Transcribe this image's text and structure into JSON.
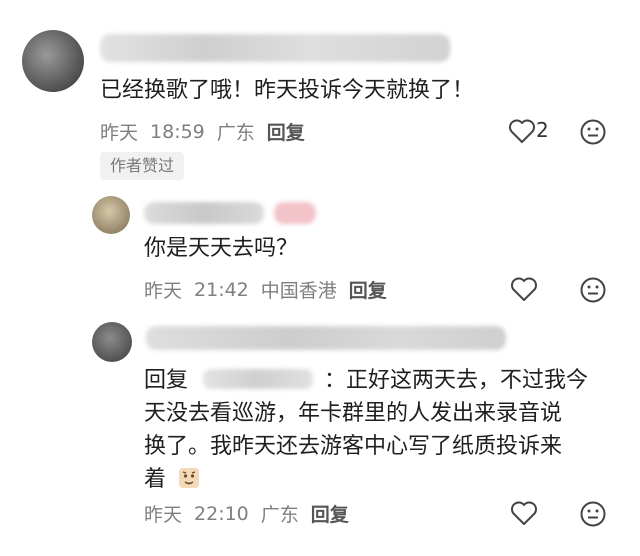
{
  "comments": [
    {
      "text": "已经换歌了哦！昨天投诉今天就换了！",
      "meta": {
        "date": "昨天",
        "time": "18:59",
        "location": "广东",
        "reply_label": "回复"
      },
      "like_count": "2",
      "author_badge": "作者赞过"
    },
    {
      "text": "你是天天去吗？",
      "meta": {
        "date": "昨天",
        "time": "21:42",
        "location": "中国香港",
        "reply_label": "回复"
      }
    },
    {
      "reply_prefix": "回复",
      "text_line1": "：正好这两天去，不过我今",
      "text_line2": "天没去看巡游，年卡群里的人发出来录音说",
      "text_line3": "换了。我昨天还去游客中心写了纸质投诉来",
      "text_line4": "着",
      "meta": {
        "date": "昨天",
        "time": "22:10",
        "location": "广东",
        "reply_label": "回复"
      }
    }
  ],
  "colors": {
    "text": "#1f1f1f",
    "meta": "#7f7f7f",
    "badge_bg": "#f1f1f1"
  },
  "icons": [
    "heart-icon",
    "emoji-icon",
    "sticker-icon"
  ]
}
